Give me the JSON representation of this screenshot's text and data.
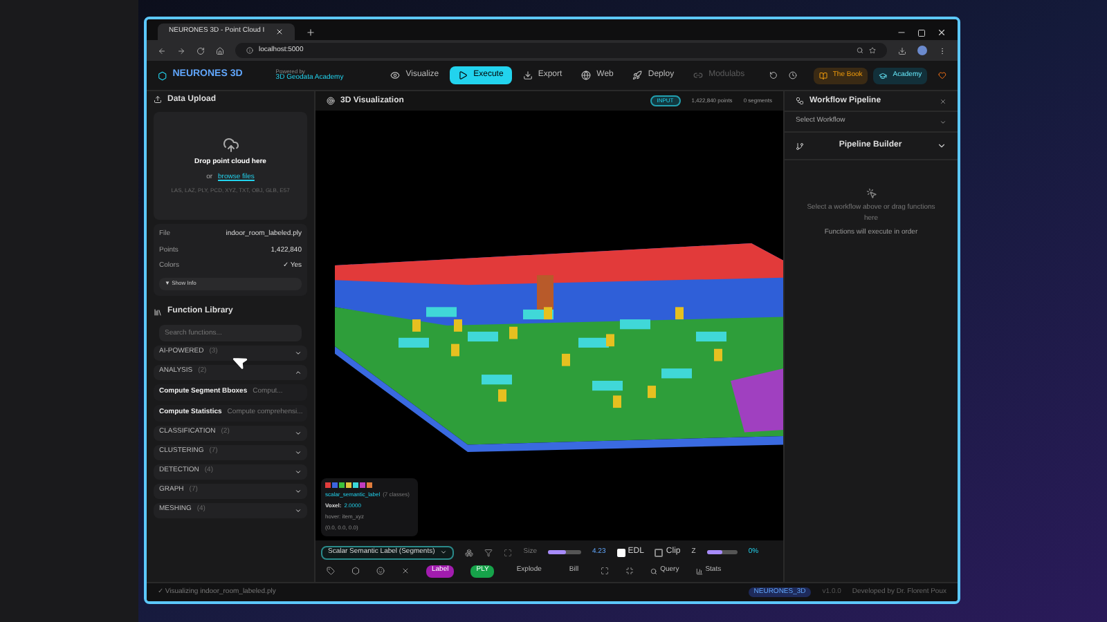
{
  "browser": {
    "tab_title": "NEURONES 3D - Point Cloud I",
    "url": "localhost:5000"
  },
  "header": {
    "logo": "NEURONES 3D",
    "powered_by": "Powered by",
    "academy_link": "3D Geodata Academy",
    "nav": [
      {
        "label": "Visualize",
        "selected": false,
        "disabled": false,
        "kind": "eye"
      },
      {
        "label": "Execute",
        "selected": true,
        "disabled": false,
        "kind": "play"
      },
      {
        "label": "Export",
        "selected": false,
        "disabled": false,
        "kind": "download"
      },
      {
        "label": "Web",
        "selected": false,
        "disabled": false,
        "kind": "globe"
      },
      {
        "label": "Deploy",
        "selected": false,
        "disabled": false,
        "kind": "rocket"
      },
      {
        "label": "Modulabs",
        "selected": false,
        "disabled": true,
        "kind": "link"
      }
    ],
    "book_button": "The Book",
    "academy_button": "Academy"
  },
  "upload": {
    "title": "Data Upload",
    "drop_text": "Drop point cloud here",
    "or": "or",
    "browse": "browse files",
    "formats": "LAS, LAZ, PLY, PCD, XYZ, TXT, OBJ, GLB, E57",
    "info": [
      {
        "label": "File",
        "value": "indoor_room_labeled.ply"
      },
      {
        "label": "Points",
        "value": "1,422,840"
      },
      {
        "label": "Colors",
        "value": "✓ Yes"
      }
    ],
    "show_info": "▼ Show Info"
  },
  "library": {
    "title": "Function Library",
    "placeholder": "Search functions...",
    "categories": [
      {
        "name": "AI-POWERED",
        "count": "(3)",
        "expanded": false
      },
      {
        "name": "ANALYSIS",
        "count": "(2)",
        "expanded": true,
        "functions": [
          {
            "name": "Compute Segment Bboxes",
            "desc": "Comput..."
          },
          {
            "name": "Compute Statistics",
            "desc": "Compute comprehensi..."
          }
        ]
      },
      {
        "name": "CLASSIFICATION",
        "count": "(2)",
        "expanded": false
      },
      {
        "name": "CLUSTERING",
        "count": "(7)",
        "expanded": false
      },
      {
        "name": "DETECTION",
        "count": "(4)",
        "expanded": false
      },
      {
        "name": "GRAPH",
        "count": "(7)",
        "expanded": false
      },
      {
        "name": "MESHING",
        "count": "(4)",
        "expanded": false
      }
    ]
  },
  "viewer": {
    "title": "3D Visualization",
    "badge": "INPUT",
    "points": "1,422,840 points",
    "segments": "0 segments",
    "legend": {
      "swatches": [
        {
          "color": "#e03c3c"
        },
        {
          "color": "#3c64e0"
        },
        {
          "color": "#3cc03c"
        },
        {
          "color": "#e0c03c"
        },
        {
          "color": "#3cd8d8"
        },
        {
          "color": "#c03cc0"
        },
        {
          "color": "#e07c3c"
        }
      ],
      "field": "scalar_semantic_label",
      "classes": "(7 classes)",
      "voxel_label": "Voxel:",
      "voxel_value": "2.0000",
      "hover": "hover: item_xyz",
      "coords": "(0.0, 0.0, 0.0)"
    },
    "toolbar": {
      "scalar_field": "Scalar Semantic Label (Segments)",
      "size_label": "Size",
      "size": {
        "level": 0.55
      },
      "size_reading": "4.23",
      "edl": {
        "label": "EDL",
        "checked": true
      },
      "clip": {
        "label": "Clip",
        "checked": false
      },
      "axis": "Z",
      "clip_level": {
        "level": 0.5
      },
      "clip_reading": "0%",
      "actions": [
        {
          "label": "Label",
          "kind": "purple"
        },
        {
          "label": "PLY",
          "kind": "green"
        },
        {
          "label": "Explode",
          "kind": "plain"
        },
        {
          "label": "Bill",
          "kind": "plain"
        }
      ],
      "query": "Query",
      "stats": "Stats"
    }
  },
  "workflow": {
    "title": "Workflow Pipeline",
    "select": "Select Workflow",
    "builder": "Pipeline Builder",
    "empty": "Select a workflow above or drag functions here",
    "hint": "Functions will execute in order"
  },
  "status_bar": {
    "message": "✓ Visualizing indoor_room_labeled.ply",
    "brand": "NEURONES_3D",
    "version": "v1.0.0",
    "credit": "Developed by Dr. Florent Poux"
  }
}
